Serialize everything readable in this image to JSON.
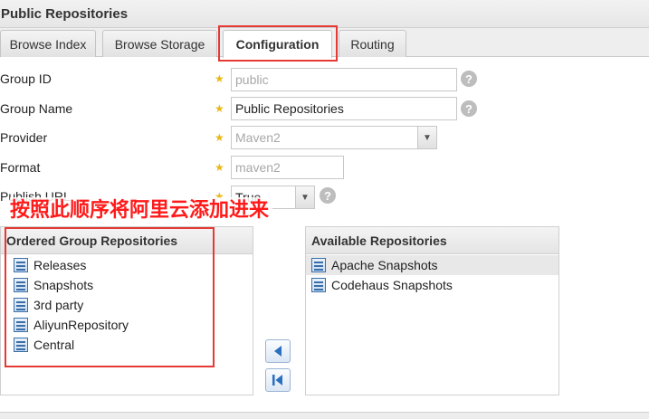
{
  "window": {
    "title": "Public Repositories"
  },
  "tabs": [
    {
      "label": "Browse Index"
    },
    {
      "label": "Browse Storage"
    },
    {
      "label": "Configuration"
    },
    {
      "label": "Routing"
    }
  ],
  "form": {
    "group_id": {
      "label": "Group ID",
      "value": "public"
    },
    "group_name": {
      "label": "Group Name",
      "value": "Public Repositories"
    },
    "provider": {
      "label": "Provider",
      "value": "Maven2"
    },
    "format": {
      "label": "Format",
      "value": "maven2"
    },
    "publish_url": {
      "label": "Publish URL",
      "value": "True"
    },
    "required_marker": "★",
    "help_marker": "?"
  },
  "annotation": "按照此顺序将阿里云添加进来",
  "ordered_panel": {
    "title": "Ordered Group Repositories",
    "items": [
      "Releases",
      "Snapshots",
      "3rd party",
      "AliyunRepository",
      "Central"
    ]
  },
  "available_panel": {
    "title": "Available Repositories",
    "items": [
      "Apache Snapshots",
      "Codehaus Snapshots"
    ]
  },
  "colors": {
    "highlight": "#e53935",
    "annotation": "#ff1a1a",
    "required": "#e8b818"
  }
}
